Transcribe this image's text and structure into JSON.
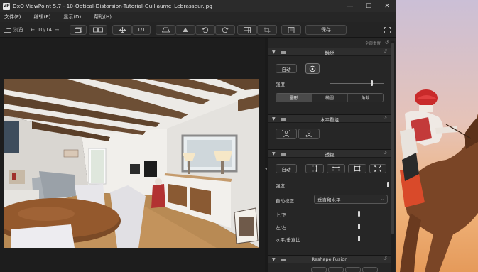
{
  "window": {
    "logo": "VP",
    "title": "DxO ViewPoint 5.7 - 10-Optical-Distorsion-Tutorial-Guillaume_Lebrasseur.jpg",
    "minimize": "—",
    "maximize": "☐",
    "close": "✕"
  },
  "menu": [
    "文件(F)",
    "编辑(E)",
    "显示(D)",
    "帮助(H)"
  ],
  "toolbar": {
    "browse": "浏览",
    "nav_counter": "10/14",
    "zoom_ratio": "1/1",
    "save": "保存"
  },
  "panel": {
    "top_label": "全部重置",
    "section_volume": {
      "title": "触觉",
      "auto": "自动",
      "intensity_label": "强度",
      "intensity_value": 0.78,
      "modes": [
        "圆形",
        "椭圆",
        "角截"
      ],
      "selected_mode": 0
    },
    "section_horizon": {
      "title": "水平重组"
    },
    "section_perspective": {
      "title": "透视",
      "auto": "自动",
      "intensity_label": "强度",
      "intensity_value": 1.0,
      "auto_correct_label": "自动校正",
      "auto_correct_value": "垂直和水平",
      "up_down_label": "上/下",
      "up_down_value": 0.5,
      "left_right_label": "左/右",
      "left_right_value": 0.5,
      "ratio_label": "水平/垂直比",
      "ratio_value": 0.5
    },
    "section_reshape": {
      "title": "Reshape Fusion"
    }
  },
  "colors": {
    "accent": "#2f2f2f",
    "active_seg": "#4a4a4a"
  }
}
